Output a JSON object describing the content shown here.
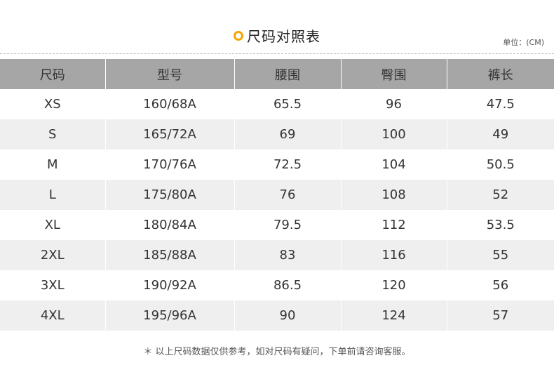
{
  "header": {
    "title": "尺码对照表",
    "unit": "单位：(CM)"
  },
  "table": {
    "columns": [
      "尺码",
      "型号",
      "腰围",
      "臀围",
      "裤长"
    ],
    "rows": [
      [
        "XS",
        "160/68A",
        "65.5",
        "96",
        "47.5"
      ],
      [
        "S",
        "165/72A",
        "69",
        "100",
        "49"
      ],
      [
        "M",
        "170/76A",
        "72.5",
        "104",
        "50.5"
      ],
      [
        "L",
        "175/80A",
        "76",
        "108",
        "52"
      ],
      [
        "XL",
        "180/84A",
        "79.5",
        "112",
        "53.5"
      ],
      [
        "2XL",
        "185/88A",
        "83",
        "116",
        "55"
      ],
      [
        "3XL",
        "190/92A",
        "86.5",
        "120",
        "56"
      ],
      [
        "4XL",
        "195/96A",
        "90",
        "124",
        "57"
      ]
    ]
  },
  "footer": {
    "note": "＊ 以上尺码数据仅供参考，如对尺码有疑问，下单前请咨询客服。"
  },
  "colors": {
    "accent": "#f5a500",
    "header_bg": "#a6a6a6",
    "stripe_bg": "#efefef"
  }
}
